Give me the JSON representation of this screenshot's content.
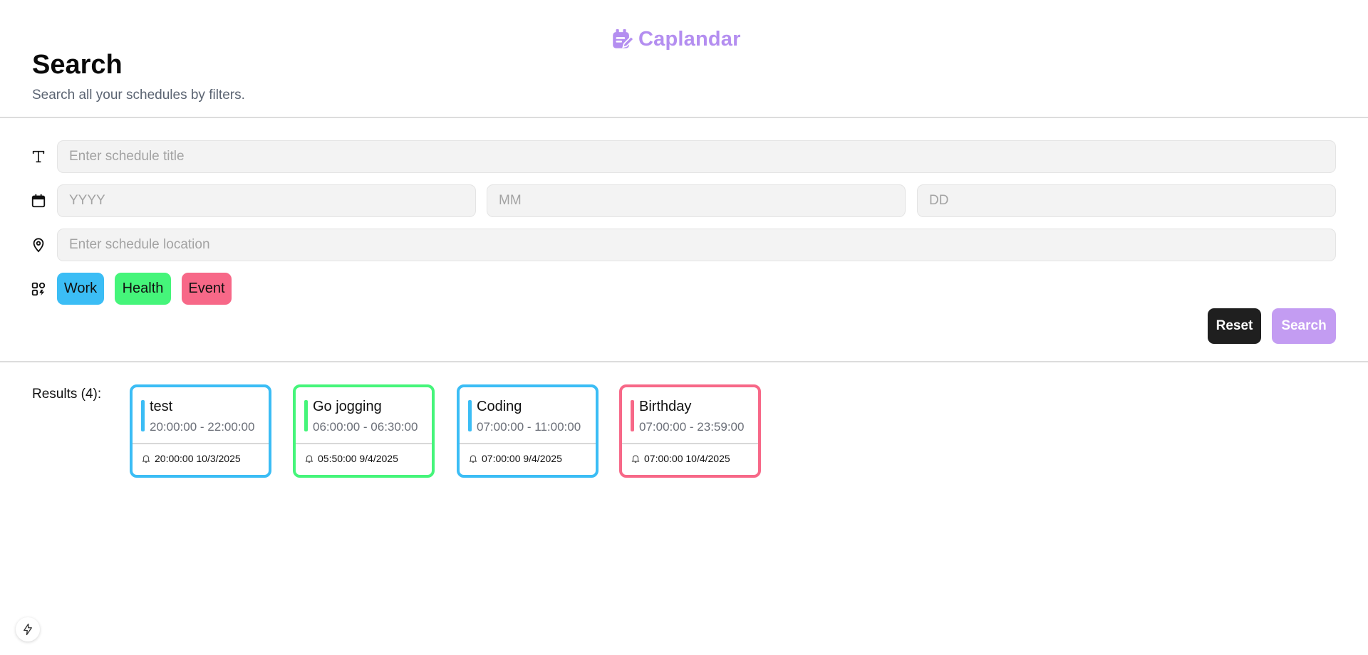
{
  "brand": {
    "name": "Caplandar",
    "icon": "calendar-edit-icon",
    "color": "#b48ef0"
  },
  "header": {
    "title": "Search",
    "subtitle": "Search all your schedules by filters."
  },
  "filters": {
    "title_field": {
      "icon": "text-icon",
      "placeholder": "Enter schedule title",
      "value": ""
    },
    "date_fields": {
      "icon": "calendar-icon",
      "year_placeholder": "YYYY",
      "month_placeholder": "MM",
      "day_placeholder": "DD"
    },
    "location_field": {
      "icon": "location-pin-icon",
      "placeholder": "Enter schedule location",
      "value": ""
    },
    "categories": {
      "icon": "category-icon",
      "items": [
        {
          "label": "Work",
          "color": "#3bbdf5"
        },
        {
          "label": "Health",
          "color": "#45f57a"
        },
        {
          "label": "Event",
          "color": "#f76888"
        }
      ]
    }
  },
  "actions": {
    "reset_label": "Reset",
    "search_label": "Search"
  },
  "results": {
    "label": "Results (4):",
    "items": [
      {
        "title": "test",
        "time": "20:00:00 - 22:00:00",
        "alarm": "20:00:00 10/3/2025",
        "category": "Work",
        "color": "#3bbdf5"
      },
      {
        "title": "Go jogging",
        "time": "06:00:00 - 06:30:00",
        "alarm": "05:50:00 9/4/2025",
        "category": "Health",
        "color": "#45f57a"
      },
      {
        "title": "Coding",
        "time": "07:00:00 - 11:00:00",
        "alarm": "07:00:00 9/4/2025",
        "category": "Work",
        "color": "#3bbdf5"
      },
      {
        "title": "Birthday",
        "time": "07:00:00 - 23:59:00",
        "alarm": "07:00:00 10/4/2025",
        "category": "Event",
        "color": "#f76888"
      }
    ]
  },
  "floating_button": {
    "icon": "lightning-icon"
  }
}
